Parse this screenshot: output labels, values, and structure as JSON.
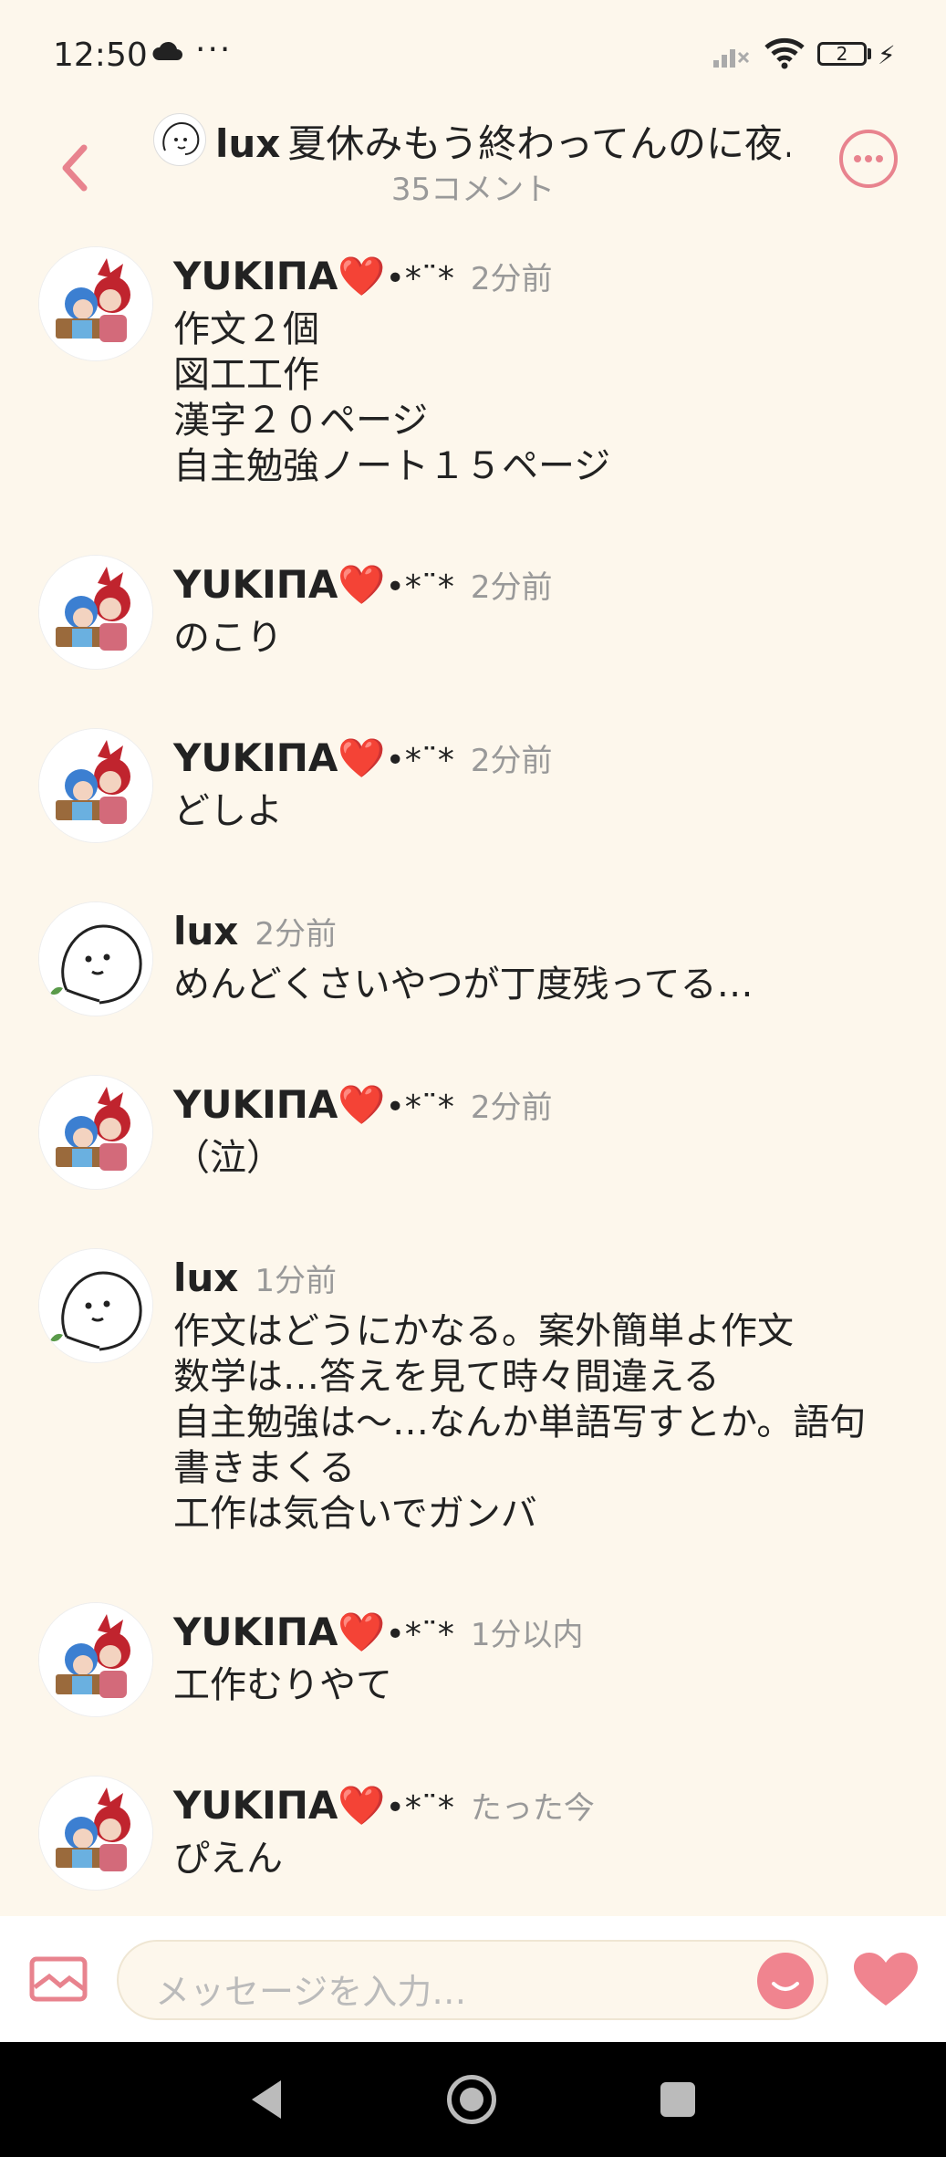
{
  "status_bar": {
    "time": "12:50",
    "dots": "···",
    "battery": "2",
    "icons": [
      "cloud-icon",
      "signal-icon",
      "wifi-icon",
      "battery-icon",
      "charging-icon"
    ]
  },
  "header": {
    "user": "lux",
    "title": "夏休みもう終わってんのに夜…",
    "subtitle": "35コメント"
  },
  "messages": [
    {
      "author": "YUKIΠA",
      "heart": "❤️",
      "deco": "•*¨*",
      "time": "2分前",
      "text": "作文２個\n図工工作\n漢字２０ページ\n自主勉強ノート１５ページ",
      "avatar": "anime"
    },
    {
      "author": "YUKIΠA",
      "heart": "❤️",
      "deco": "•*¨*",
      "time": "2分前",
      "text": "のこり",
      "avatar": "anime"
    },
    {
      "author": "YUKIΠA",
      "heart": "❤️",
      "deco": "•*¨*",
      "time": "2分前",
      "text": "どしよ",
      "avatar": "anime"
    },
    {
      "author": "lux",
      "heart": "",
      "deco": "",
      "time": "2分前",
      "text": "めんどくさいやつが丁度残ってる…",
      "avatar": "doodle"
    },
    {
      "author": "YUKIΠA",
      "heart": "❤️",
      "deco": "•*¨*",
      "time": "2分前",
      "text": "（泣）",
      "avatar": "anime"
    },
    {
      "author": "lux",
      "heart": "",
      "deco": "",
      "time": "1分前",
      "text": "作文はどうにかなる。案外簡単よ作文\n数学は…答えを見て時々間違える\n自主勉強は〜…なんか単語写すとか。語句\n書きまくる\n工作は気合いでガンバ",
      "avatar": "doodle"
    },
    {
      "author": "YUKIΠA",
      "heart": "❤️",
      "deco": "•*¨*",
      "time": "1分以内",
      "text": "工作むりやて",
      "avatar": "anime"
    },
    {
      "author": "YUKIΠA",
      "heart": "❤️",
      "deco": "•*¨*",
      "time": "たった今",
      "text": "ぴえん",
      "avatar": "anime"
    }
  ],
  "composer": {
    "placeholder": "メッセージを入力…"
  },
  "colors": {
    "background": "#fdf7ec",
    "accent": "#e8838e",
    "heart": "#e0313b"
  }
}
